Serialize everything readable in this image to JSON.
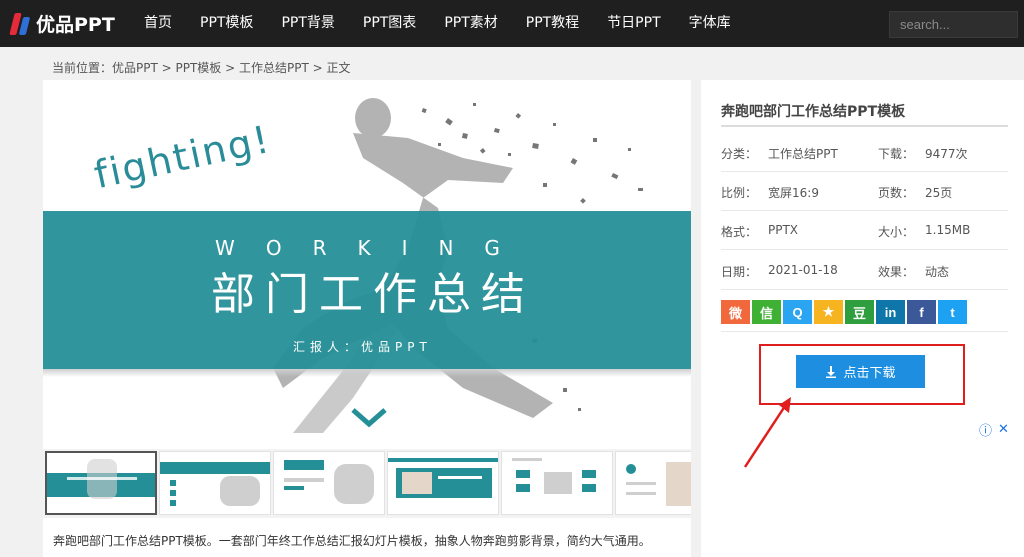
{
  "site": {
    "logo_text": "优品PPT"
  },
  "nav": [
    "首页",
    "PPT模板",
    "PPT背景",
    "PPT图表",
    "PPT素材",
    "PPT教程",
    "节日PPT",
    "字体库"
  ],
  "search": {
    "placeholder": "search..."
  },
  "breadcrumb": "当前位置：优品PPT > PPT模板 > 工作总结PPT > 正文",
  "slide": {
    "script_text": "fighting!",
    "spaced_text": "WORKING",
    "title": "部门工作总结",
    "presenter": "汇报人：优品PPT"
  },
  "description": "奔跑吧部门工作总结PPT模板。一套部门年终工作总结汇报幻灯片模板，抽象人物奔跑剪影背景，简约大气通用。",
  "sidebar": {
    "title": "奔跑吧部门工作总结PPT模板",
    "rows": [
      {
        "l1": "分类：",
        "v1": "工作总结PPT",
        "l2": "下载：",
        "v2": "9477次"
      },
      {
        "l1": "比例：",
        "v1": "宽屏16:9",
        "l2": "页数：",
        "v2": "25页"
      },
      {
        "l1": "格式：",
        "v1": "PPTX",
        "l2": "大小：",
        "v2": "1.15MB"
      },
      {
        "l1": "日期：",
        "v1": "2021-01-18",
        "l2": "效果：",
        "v2": "动态"
      }
    ],
    "share_icons": [
      {
        "name": "weibo-icon",
        "glyph": "微",
        "color": "#f0683b"
      },
      {
        "name": "wechat-icon",
        "glyph": "信",
        "color": "#3eb135"
      },
      {
        "name": "qq-icon",
        "glyph": "Q",
        "color": "#2ba4f1"
      },
      {
        "name": "qzone-icon",
        "glyph": "★",
        "color": "#f7b421"
      },
      {
        "name": "douban-icon",
        "glyph": "豆",
        "color": "#2f9e3e"
      },
      {
        "name": "linkedin-icon",
        "glyph": "in",
        "color": "#0e76a8"
      },
      {
        "name": "facebook-icon",
        "glyph": "f",
        "color": "#3b5998"
      },
      {
        "name": "twitter-icon",
        "glyph": "t",
        "color": "#1da1f2"
      }
    ],
    "download_label": "点击下载"
  },
  "colors": {
    "teal": "#258f97",
    "accent_blue": "#1e8fe0",
    "highlight_red": "#e01e1e"
  }
}
